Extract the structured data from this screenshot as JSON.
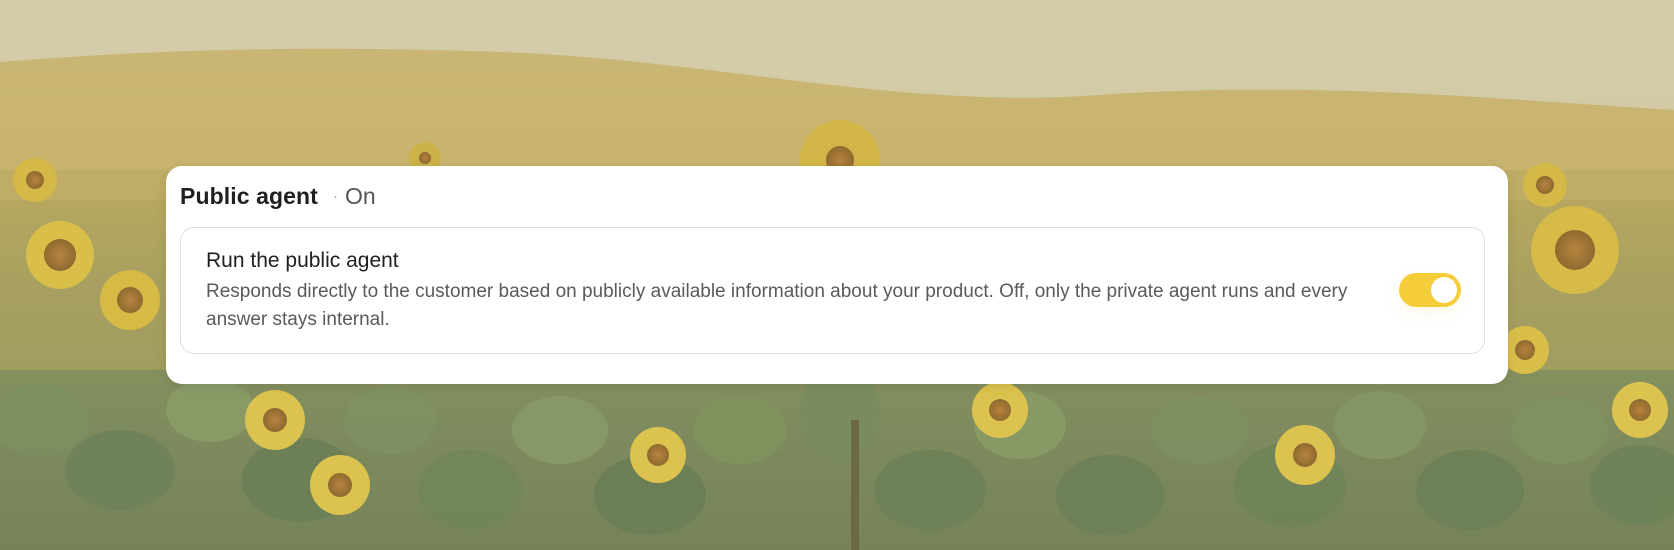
{
  "panel": {
    "title": "Public agent",
    "separator": "·",
    "status": "On"
  },
  "setting": {
    "title": "Run the public agent",
    "description": "Responds directly to the customer based on publicly available information about your product. Off, only the private agent runs and every answer stays internal.",
    "toggle": {
      "state": "on",
      "accent_color": "#f5cd3b"
    }
  }
}
